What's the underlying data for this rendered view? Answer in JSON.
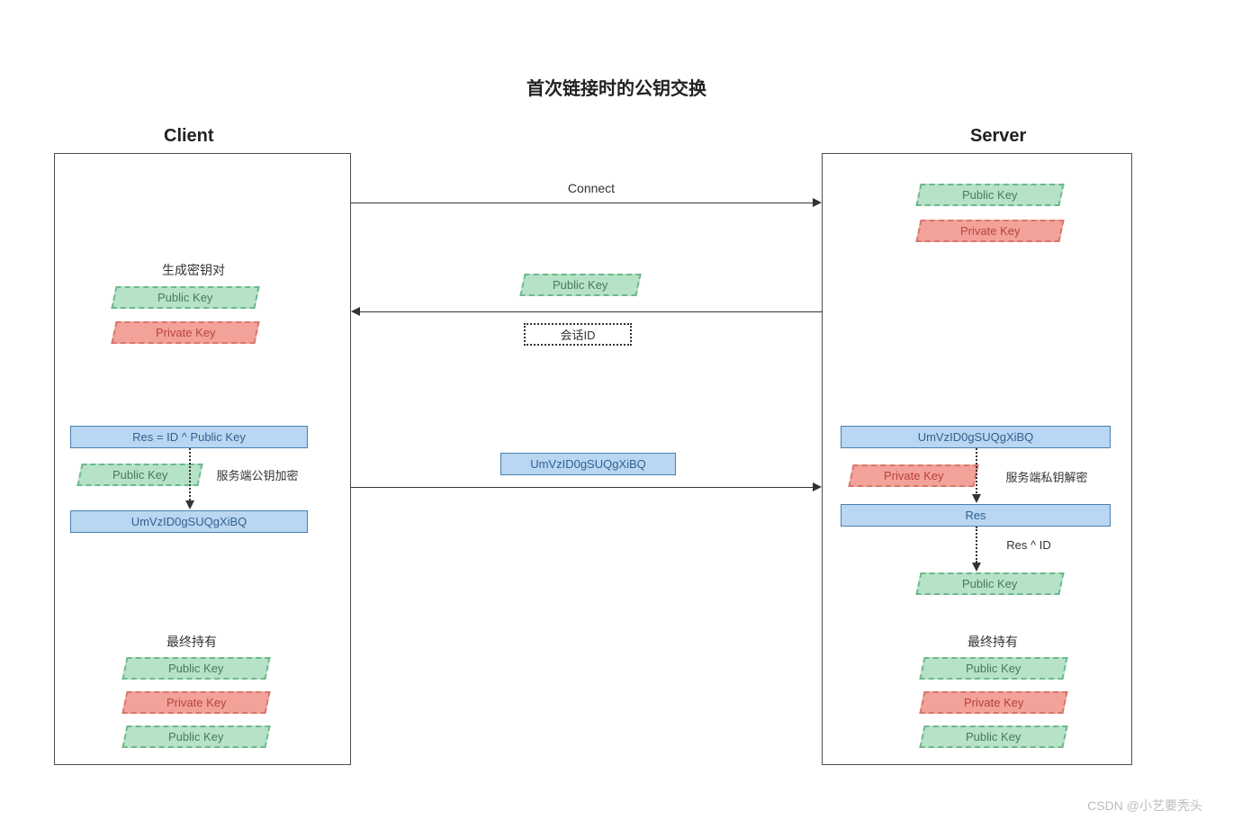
{
  "title": "首次链接时的公钥交换",
  "client_label": "Client",
  "server_label": "Server",
  "labels": {
    "connect": "Connect",
    "public_key": "Public Key",
    "private_key": "Private Key",
    "session_id": "会话ID",
    "gen_keypair": "生成密钥对",
    "res_formula": "Res = ID ^ Public Key",
    "cipher": "UmVzID0gSUQgXiBQ",
    "enc_with_server_pub": "服务端公钥加密",
    "dec_with_server_priv": "服务端私钥解密",
    "res": "Res",
    "res_xor_id": "Res ^ ID",
    "final_holds": "最终持有"
  },
  "watermark": "CSDN @小艺要秃头"
}
